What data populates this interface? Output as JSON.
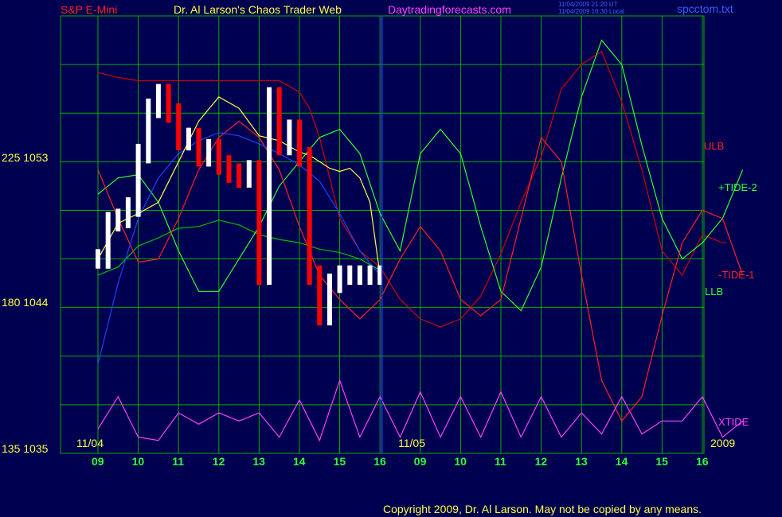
{
  "header": {
    "symbol": "S&P E-Mini",
    "title": "Dr. Al Larson's Chaos Trader Web",
    "site": "Daytradingforecasts.com",
    "stamp_line1": "11/04/2009 21:20 UT",
    "stamp_line2": "11/04/2009 16:30 Local",
    "file": "spcctom.txt"
  },
  "footer": {
    "copyright": "Copyright 2009, Dr. Al Larson. May not be copied by any means."
  },
  "colors": {
    "background": "#000050",
    "grid": "#00b000",
    "price_up": "#ffffff",
    "price_down": "#ff0000",
    "ulb": "#d00000",
    "llb": "#00c000",
    "tide1": "#ff2020",
    "tide2": "#30ff30",
    "xtide": "#ff40ff",
    "slow_avg": "#2040ff",
    "fast_avg": "#ffff40",
    "cursor": "#2040ff"
  },
  "chart_data": {
    "type": "line",
    "title": "S&P E-Mini",
    "xlabel": "",
    "ylabel": "",
    "ylim": [
      1035,
      1062
    ],
    "grid": true,
    "x_ticks": [
      "09",
      "10",
      "11",
      "12",
      "13",
      "14",
      "15",
      "16",
      "09",
      "10",
      "11",
      "12",
      "13",
      "14",
      "15",
      "16"
    ],
    "date_labels": [
      "11/04",
      "11/05",
      "2009"
    ],
    "y_ticks": [
      {
        "price": 1035,
        "count": 135,
        "label": "135 1035"
      },
      {
        "price": 1044,
        "count": 180,
        "label": "180 1044"
      },
      {
        "price": 1053,
        "count": 225,
        "label": "225 1053"
      }
    ],
    "cursor_at": "11/05",
    "price_bars": {
      "name": "S&P E-Mini",
      "x": [
        0,
        0.25,
        0.5,
        0.75,
        1.0,
        1.25,
        1.5,
        1.75,
        2.0,
        2.25,
        2.5,
        2.75,
        3.0,
        3.25,
        3.5,
        3.75,
        4.0,
        4.25,
        4.5,
        4.75,
        5.0,
        5.25,
        5.5,
        5.75,
        6.0,
        6.25,
        6.5,
        6.75,
        7.0
      ],
      "close": [
        1047.0,
        1049.3,
        1049.5,
        1050.2,
        1053.5,
        1056.3,
        1057.2,
        1056.0,
        1054.3,
        1054.5,
        1053.3,
        1053.8,
        1052.8,
        1052.3,
        1052.0,
        1052.5,
        1046.0,
        1057.0,
        1054.0,
        1055.0,
        1053.3,
        1046.0,
        1043.5,
        1045.5,
        1046.0,
        1046.0,
        1046.0,
        1046.0,
        1046.0
      ]
    },
    "series": [
      {
        "name": "ULB",
        "x": [
          0,
          0.5,
          1.0,
          1.5,
          2.0,
          2.5,
          3.0,
          3.5,
          4.0,
          4.5,
          5.0,
          5.25,
          5.5,
          6.0,
          6.5,
          7.0,
          7.5,
          8.0,
          8.5,
          9.0,
          9.5,
          10.0,
          10.5,
          11.0,
          11.5,
          12.0,
          12.5,
          13.0,
          13.5,
          14.0,
          14.5,
          15.0,
          15.5,
          15.6
        ],
        "y": [
          1058.5,
          1058.2,
          1058.0,
          1058.0,
          1058.0,
          1058.0,
          1058.0,
          1058.0,
          1058.0,
          1058.0,
          1057.3,
          1056.3,
          1054.5,
          1049.5,
          1047.5,
          1046.5,
          1044.5,
          1043.3,
          1042.8,
          1043.3,
          1044.7,
          1047.3,
          1050.5,
          1053.3,
          1057.5,
          1059.0,
          1059.8,
          1056.7,
          1052.5,
          1047.5,
          1046.0,
          1048.5,
          1048.0,
          1048.0
        ]
      },
      {
        "name": "LLB",
        "x": [
          0,
          0.5,
          1.0,
          1.5,
          2.0,
          2.5,
          3.0,
          3.5,
          4.0,
          4.5,
          5.0,
          5.5,
          6.0,
          6.5,
          7.0
        ],
        "y": [
          1046.0,
          1046.5,
          1047.8,
          1048.3,
          1048.9,
          1049.0,
          1049.4,
          1049.1,
          1048.5,
          1048.2,
          1048.0,
          1047.6,
          1047.4,
          1047.0,
          1046.3
        ]
      },
      {
        "name": "+TIDE-2",
        "x": [
          0,
          0.5,
          1.0,
          1.5,
          2.0,
          2.5,
          3.0,
          3.5,
          4.0,
          4.5,
          5.0,
          5.5,
          6.0,
          6.5,
          7.0,
          7.5,
          8.0,
          8.5,
          9.0,
          9.5,
          10.0,
          10.5,
          11.0,
          11.5,
          12.0,
          12.5,
          13.0,
          13.5,
          14.0,
          14.5,
          15.0,
          15.5,
          16.0
        ],
        "y": [
          1051.0,
          1052.0,
          1052.2,
          1050.5,
          1047.5,
          1045.0,
          1045.0,
          1047.0,
          1049.0,
          1051.5,
          1053.0,
          1054.5,
          1055.0,
          1053.5,
          1049.8,
          1047.5,
          1053.5,
          1055.0,
          1053.5,
          1049.0,
          1045.0,
          1043.8,
          1046.5,
          1052.0,
          1057.0,
          1060.5,
          1059.0,
          1054.0,
          1049.5,
          1047.0,
          1048.0,
          1049.5,
          1052.5
        ]
      },
      {
        "name": "-TIDE-1",
        "x": [
          0,
          0.5,
          1.0,
          1.5,
          2.0,
          2.5,
          3.0,
          3.5,
          4.0,
          4.5,
          5.0,
          5.5,
          6.0,
          6.5,
          7.0,
          7.5,
          8.0,
          8.5,
          9.0,
          9.5,
          10.0,
          10.5,
          11.0,
          11.5,
          12.0,
          12.5,
          13.0,
          13.5,
          14.0,
          14.5,
          15.0,
          15.5,
          16.0
        ],
        "y": [
          1052.5,
          1049.5,
          1046.8,
          1047.0,
          1049.5,
          1052.5,
          1054.5,
          1055.5,
          1054.5,
          1052.5,
          1049.0,
          1046.0,
          1044.5,
          1043.3,
          1044.5,
          1047.0,
          1049.0,
          1047.5,
          1044.5,
          1043.5,
          1044.5,
          1049.5,
          1054.5,
          1053.0,
          1046.0,
          1039.5,
          1037.0,
          1038.5,
          1043.5,
          1048.0,
          1050.0,
          1049.5,
          1046.0
        ]
      },
      {
        "name": "XTIDE",
        "x": [
          0,
          0.5,
          1.0,
          1.5,
          2.0,
          2.5,
          3.0,
          3.5,
          4.0,
          4.5,
          5.0,
          5.5,
          6.0,
          6.5,
          7.0,
          7.5,
          8.0,
          8.5,
          9.0,
          9.5,
          10.0,
          10.5,
          11.0,
          11.5,
          12.0,
          12.5,
          13.0,
          13.5,
          14.0,
          14.5,
          15.0,
          15.5,
          16.0
        ],
        "y": [
          1036.5,
          1038.5,
          1036.0,
          1035.8,
          1037.5,
          1036.8,
          1037.5,
          1037.0,
          1037.5,
          1036.0,
          1038.3,
          1035.8,
          1039.5,
          1036.0,
          1038.5,
          1036.0,
          1038.8,
          1036.0,
          1038.5,
          1036.0,
          1038.8,
          1036.0,
          1038.5,
          1036.0,
          1037.5,
          1036.2,
          1038.5,
          1036.2,
          1037.0,
          1037.0,
          1038.5,
          1036.0,
          1037.0
        ]
      },
      {
        "name": "slow average",
        "x": [
          0,
          0.5,
          1.0,
          1.5,
          2.0,
          2.5,
          3.0,
          3.5,
          4.0,
          4.5,
          5.0,
          5.5,
          6.0,
          6.5,
          7.0
        ],
        "y": [
          1040.5,
          1045.5,
          1049.5,
          1052.0,
          1053.5,
          1054.3,
          1054.8,
          1054.6,
          1054.1,
          1053.5,
          1052.8,
          1051.8,
          1049.8,
          1047.5,
          1046.0
        ]
      },
      {
        "name": "fast average",
        "x": [
          0,
          0.5,
          1.0,
          1.5,
          2.0,
          2.5,
          3.0,
          3.5,
          4.0,
          4.5,
          5.0,
          5.25,
          5.5,
          5.75,
          6.0,
          6.25,
          6.5,
          6.75,
          7.0
        ],
        "y": [
          1047.0,
          1049.2,
          1049.8,
          1050.5,
          1053.0,
          1055.5,
          1057.0,
          1056.3,
          1054.6,
          1054.3,
          1053.6,
          1053.4,
          1053.0,
          1052.6,
          1052.4,
          1052.6,
          1052.0,
          1050.5,
          1046.0
        ]
      }
    ],
    "series_labels": [
      {
        "name": "ULB",
        "color": "#ff2020"
      },
      {
        "name": "+TIDE-2",
        "color": "#30ff30"
      },
      {
        "name": "-TIDE-1",
        "color": "#ff2020"
      },
      {
        "name": "LLB",
        "color": "#30ff30"
      },
      {
        "name": "XTIDE",
        "color": "#ff40ff"
      }
    ]
  }
}
